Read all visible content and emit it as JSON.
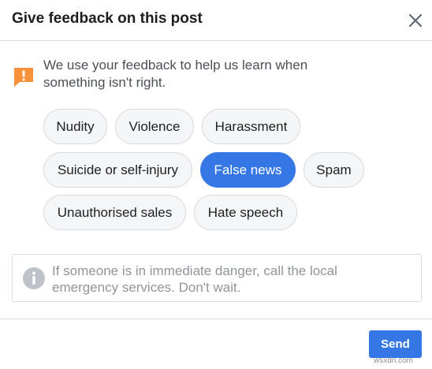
{
  "dialog": {
    "title": "Give feedback on this post",
    "close_icon": "close-icon"
  },
  "intro": {
    "icon": "exclamation-flag-icon",
    "icon_color": "#f7923b",
    "text": "We use your feedback to help us learn when something isn't right."
  },
  "options": [
    {
      "label": "Nudity",
      "selected": false
    },
    {
      "label": "Violence",
      "selected": false
    },
    {
      "label": "Harassment",
      "selected": false
    },
    {
      "label": "Suicide or self-injury",
      "selected": false
    },
    {
      "label": "False news",
      "selected": true
    },
    {
      "label": "Spam",
      "selected": false
    },
    {
      "label": "Unauthorised sales",
      "selected": false
    },
    {
      "label": "Hate speech",
      "selected": false
    }
  ],
  "notice": {
    "icon": "info-icon",
    "text": "If someone is in immediate danger, call the local emergency services. Don't wait."
  },
  "footer": {
    "send_label": "Send"
  },
  "colors": {
    "accent": "#3578e5",
    "warning": "#f7923b"
  },
  "watermark": "wsxdn.com"
}
